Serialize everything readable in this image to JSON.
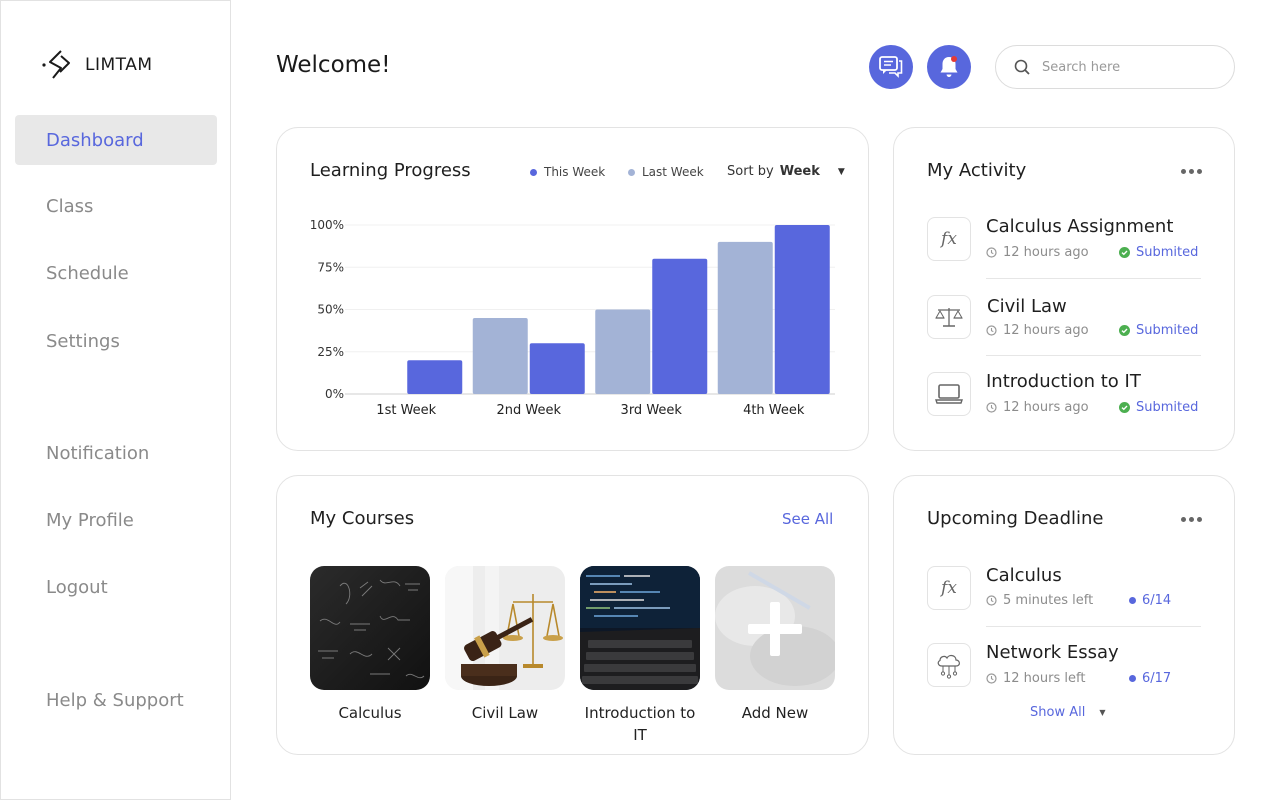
{
  "app": {
    "brand": "LIMTAM",
    "accent_color": "#5867dd",
    "secondary_color": "#a3b3d6"
  },
  "sidebar": {
    "items": [
      {
        "label": "Dashboard",
        "active": true
      },
      {
        "label": "Class"
      },
      {
        "label": "Schedule"
      },
      {
        "label": "Settings"
      },
      {
        "label": "Notification"
      },
      {
        "label": "My Profile"
      },
      {
        "label": "Logout"
      },
      {
        "label": "Help & Support"
      }
    ]
  },
  "header": {
    "title": "Welcome!",
    "message_icon": "chat-icon",
    "notification_icon": "bell-icon",
    "search_placeholder": "Search here"
  },
  "learning_progress": {
    "title": "Learning Progress",
    "legend_this_week": "This Week",
    "legend_last_week": "Last Week",
    "sort_label": "Sort by",
    "sort_value": "Week"
  },
  "chart_data": {
    "type": "bar",
    "categories": [
      "1st Week",
      "2nd Week",
      "3rd Week",
      "4th Week"
    ],
    "series": [
      {
        "name": "Last Week",
        "color": "#a3b3d6",
        "values": [
          0,
          45,
          50,
          90
        ]
      },
      {
        "name": "This Week",
        "color": "#5867dd",
        "values": [
          20,
          30,
          80,
          100
        ]
      }
    ],
    "yticks": [
      "0%",
      "25%",
      "50%",
      "75%",
      "100%"
    ],
    "ylim": [
      0,
      100
    ],
    "grid": true,
    "legend": "top-right"
  },
  "activity": {
    "title": "My Activity",
    "items": [
      {
        "title": "Calculus Assignment",
        "time": "12 hours ago",
        "status": "Submited",
        "icon": "function-icon"
      },
      {
        "title": "Civil Law",
        "time": "12 hours ago",
        "status": "Submited",
        "icon": "scale-icon"
      },
      {
        "title": "Introduction to IT",
        "time": "12 hours ago",
        "status": "Submited",
        "icon": "laptop-icon"
      }
    ]
  },
  "courses": {
    "title": "My Courses",
    "see_all": "See All",
    "items": [
      {
        "label": "Calculus"
      },
      {
        "label": "Civil Law"
      },
      {
        "label": "Introduction to IT"
      },
      {
        "label": "Add New"
      }
    ]
  },
  "deadline": {
    "title": "Upcoming Deadline",
    "items": [
      {
        "title": "Calculus",
        "time": "5 minutes left",
        "date": "6/14",
        "icon": "function-icon"
      },
      {
        "title": "Network Essay",
        "time": "12 hours left",
        "date": "6/17",
        "icon": "cloud-network-icon"
      }
    ],
    "show_all": "Show All"
  }
}
